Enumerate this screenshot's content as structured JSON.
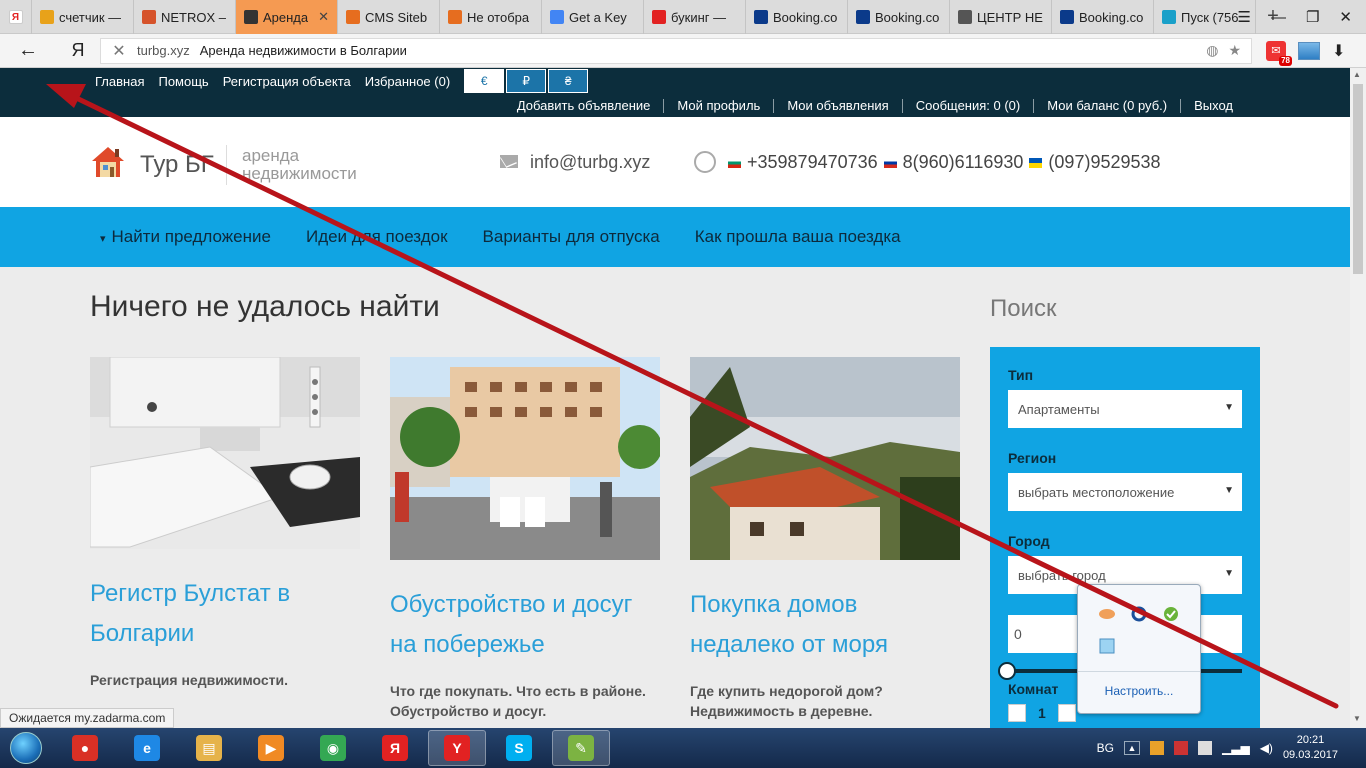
{
  "browser": {
    "tabs": [
      {
        "label": "счетчик —",
        "icon_color": "#e8a21a",
        "active": false
      },
      {
        "label": "NETROX –",
        "icon_color": "#d6532b",
        "active": false
      },
      {
        "label": "Аренда",
        "icon_color": "#333333",
        "active": true
      },
      {
        "label": "CMS Siteb",
        "icon_color": "#e66d1f",
        "active": false
      },
      {
        "label": "Не отобра",
        "icon_color": "#e66d1f",
        "active": false
      },
      {
        "label": "Get a Key",
        "icon_color": "#4285f4",
        "active": false
      },
      {
        "label": "букинг —",
        "icon_color": "#e22222",
        "active": false
      },
      {
        "label": "Booking.co",
        "icon_color": "#0b3a8a",
        "active": false
      },
      {
        "label": "Booking.co",
        "icon_color": "#0b3a8a",
        "active": false
      },
      {
        "label": "ЦЕНТР НЕ",
        "icon_color": "#555555",
        "active": false
      },
      {
        "label": "Booking.co",
        "icon_color": "#0b3a8a",
        "active": false
      },
      {
        "label": "Пуск (756",
        "icon_color": "#1aa0c9",
        "active": false
      }
    ],
    "first_tab_glyph": "Я",
    "new_tab_glyph": "+",
    "window_controls": {
      "menu": "☰",
      "minimize": "—",
      "restore": "❐",
      "close": "✕"
    },
    "address": {
      "host": "turbg.xyz",
      "page_title": "Аренда недвижимости в Болгарии"
    },
    "back_glyph": "←",
    "yandex_glyph": "Я",
    "clear_glyph": "✕",
    "extensions": {
      "translate_glyph": "◍",
      "star_glyph": "★"
    },
    "badge_count": "78",
    "download_glyph": "⬇",
    "status_text": "Ожидается my.zadarma.com"
  },
  "site": {
    "topnav": [
      "Главная",
      "Помощь",
      "Регистрация объекта",
      "Избранное (0)"
    ],
    "currencies": [
      {
        "label": "€",
        "active": true
      },
      {
        "label": "₽",
        "active": false
      },
      {
        "label": "₴",
        "active": false
      }
    ],
    "usernav": [
      "Добавить объявление",
      "Мой профиль",
      "Мои объявления",
      "Сообщения: 0 (0)",
      "Мои баланс (0 руб.)",
      "Выход"
    ],
    "brand": {
      "name": "Тур БГ",
      "tagline": "аренда недвижимости"
    },
    "email": "info@turbg.xyz",
    "phones": [
      {
        "flag": "bg",
        "number": "+359879470736"
      },
      {
        "flag": "ru",
        "number": "8(960)6116930"
      },
      {
        "flag": "ua",
        "number": "(097)9529538"
      }
    ],
    "mainnav": {
      "toggle_glyph": "▾",
      "items": [
        "Найти предложение",
        "Идеи для поездок",
        "Варианты для отпуска",
        "Как прошла ваша поездка"
      ]
    },
    "heading": "Ничего не удалось найти",
    "cards": [
      {
        "title": "Регистр Булстат в Болгарии",
        "desc": "Регистрация недвижимости."
      },
      {
        "title": "Обустройство и досуг на побережье",
        "desc": "Что где покупать. Что есть в районе. Обустройство и досуг."
      },
      {
        "title": "Покупка домов недалеко от моря",
        "desc": "Где купить недорогой дом? Недвижимость в деревне."
      }
    ],
    "search": {
      "title": "Поиск",
      "fields": [
        {
          "label": "Тип",
          "value": "Апартаменты"
        },
        {
          "label": "Регион",
          "value": "выбрать местоположение"
        },
        {
          "label": "Город",
          "value": "выбрать город"
        }
      ],
      "select_arrow": "▼",
      "price_value": "0",
      "price_fraction": 0,
      "rooms_label": "Комнат",
      "rooms_options": [
        "1"
      ]
    }
  },
  "tray_popup": {
    "configure_label": "Настроить..."
  },
  "taskbar": {
    "apps": [
      {
        "name": "microphone",
        "color": "#d93025",
        "glyph": "●",
        "active": false
      },
      {
        "name": "ie",
        "color": "#1e88e5",
        "glyph": "e",
        "active": false
      },
      {
        "name": "explorer",
        "color": "#e6b34a",
        "glyph": "▤",
        "active": false
      },
      {
        "name": "media",
        "color": "#f08a24",
        "glyph": "▶",
        "active": false
      },
      {
        "name": "chrome",
        "color": "#34a853",
        "glyph": "◉",
        "active": false
      },
      {
        "name": "yandex",
        "color": "#e22222",
        "glyph": "Я",
        "active": false
      },
      {
        "name": "yandex-browser",
        "color": "#e22222",
        "glyph": "Y",
        "active": true
      },
      {
        "name": "skype",
        "color": "#00aff0",
        "glyph": "S",
        "active": false
      },
      {
        "name": "notepad",
        "color": "#7cb342",
        "glyph": "✎",
        "active": true
      }
    ],
    "lang": "BG",
    "time": "20:21",
    "date": "09.03.2017"
  },
  "colors": {
    "site_dark": "#0c2d3c",
    "site_blue": "#10a4e3",
    "link_blue": "#2a9fd8",
    "active_tab": "#f59a52",
    "annotation_arrow": "#b8141a"
  }
}
